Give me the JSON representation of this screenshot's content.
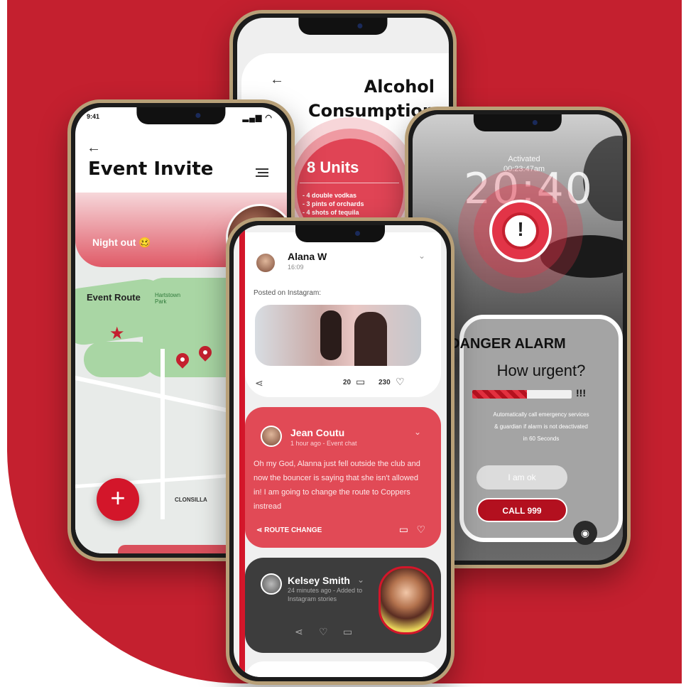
{
  "colors": {
    "accent": "#c4202f",
    "card_red": "#e14a56",
    "dark_card": "#3d3d3d"
  },
  "event_invite": {
    "status_time": "9:41",
    "title": "Event Invite",
    "night_out_label": "Night out 🥴",
    "route_label": "Event Route",
    "park_label": "Hartstown Park",
    "area_label": "CLONSILLA",
    "fab_label": "+"
  },
  "alcohol": {
    "title_line1": "Alcohol",
    "title_line2": "Consumption",
    "units": "8 Units",
    "items": [
      "- 4 double vodkas",
      "- 3 pints of orchards",
      "- 4 shots of tequila"
    ]
  },
  "alarm": {
    "activated": "Activated",
    "activated_time": "00:23:47am",
    "clock": "20:40",
    "danger_title": "DANGER ALARM",
    "question": "How urgent?",
    "urgency_level": 0.55,
    "urgency_marks": "!!!",
    "auto_text_line1": "Automatically call emergency services",
    "auto_text_line2": "& guardian if alarm is not deactivated",
    "auto_text_line3": "in 60 Seconds",
    "ok_label": "I am ok",
    "call_label": "CALL 999"
  },
  "feed": {
    "post1": {
      "name": "Alana W",
      "time": "16:09",
      "posted": "Posted on Instagram:",
      "comments": "20",
      "likes": "230"
    },
    "post2": {
      "name": "Jean Coutu",
      "time": "1 hour ago - Event chat",
      "message": "Oh my God, Alanna just fell outside the club and now the bouncer is saying that she isn't allowed in! I am going to change the route to Coppers instread",
      "action": "ROUTE CHANGE"
    },
    "post3": {
      "name": "Kelsey Smith",
      "sub": "24 minutes ago - Added to Instagram stories"
    }
  }
}
